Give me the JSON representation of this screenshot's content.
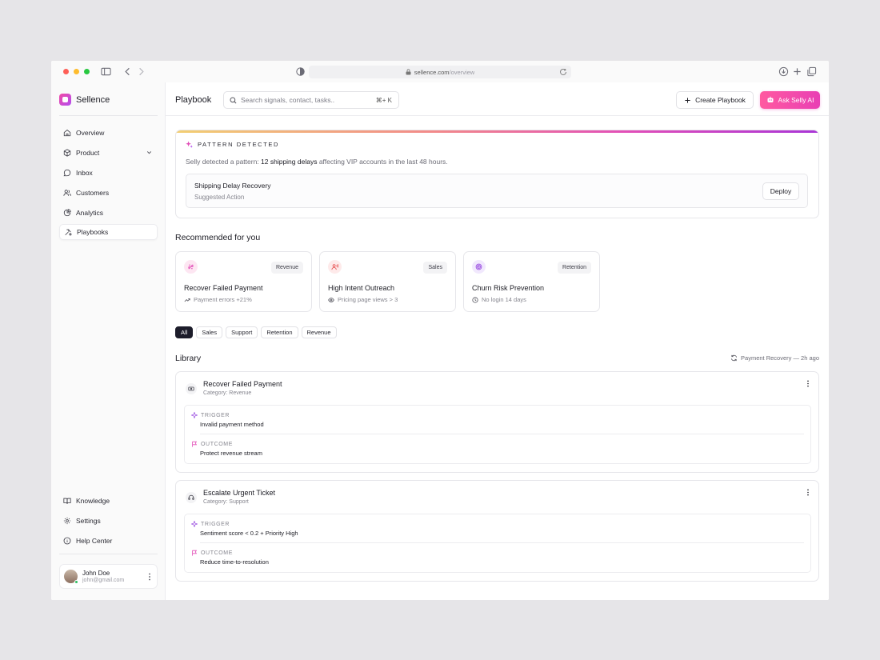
{
  "browser": {
    "url_host": "sellence.com",
    "url_path": "/overview"
  },
  "brand": {
    "name": "Sellence"
  },
  "sidebar": {
    "items": [
      {
        "label": "Overview",
        "icon": "home-icon"
      },
      {
        "label": "Product",
        "icon": "box-icon"
      },
      {
        "label": "Inbox",
        "icon": "chat-icon"
      },
      {
        "label": "Customers",
        "icon": "users-icon"
      },
      {
        "label": "Analytics",
        "icon": "chart-icon"
      },
      {
        "label": "Playbooks",
        "icon": "playbook-icon"
      }
    ],
    "bottom_items": [
      {
        "label": "Knowledge",
        "icon": "book-icon"
      },
      {
        "label": "Settings",
        "icon": "gear-icon"
      },
      {
        "label": "Help Center",
        "icon": "info-icon"
      }
    ],
    "user": {
      "name": "John Doe",
      "email": "john@gmail.com"
    }
  },
  "header": {
    "title": "Playbook",
    "search_placeholder": "Search signals, contact, tasks..",
    "search_shortcut": "⌘+ K",
    "create_label": "Create Playbook",
    "ai_label": "Ask Selly AI"
  },
  "pattern": {
    "label": "PATTERN DETECTED",
    "text_before": "Selly detected a pattern: ",
    "text_bold": "12 shipping delays",
    "text_after": " affecting VIP accounts in the last 48 hours.",
    "action_title": "Shipping Delay Recovery",
    "action_sub": "Suggested Action",
    "deploy_label": "Deploy"
  },
  "recommended": {
    "title": "Recommended for you",
    "cards": [
      {
        "title": "Recover Failed Payment",
        "tag": "Revenue",
        "meta": "Payment errors +21%"
      },
      {
        "title": "High Intent Outreach",
        "tag": "Sales",
        "meta": "Pricing page views > 3"
      },
      {
        "title": "Churn Risk Prevention",
        "tag": "Retention",
        "meta": "No login 14 days"
      }
    ]
  },
  "filters": [
    "All",
    "Sales",
    "Support",
    "Retention",
    "Revenue"
  ],
  "library": {
    "title": "Library",
    "recent": "Payment Recovery — 2h ago",
    "trigger_label": "TRIGGER",
    "outcome_label": "OUTCOME",
    "items": [
      {
        "title": "Recover Failed Payment",
        "category": "Category: Revenue",
        "trigger": "Invalid payment method",
        "outcome": "Protect revenue stream"
      },
      {
        "title": "Escalate Urgent Ticket",
        "category": "Category: Support",
        "trigger": "Sentiment score < 0.2 + Priority High",
        "outcome": "Reduce time-to-resolution"
      }
    ]
  },
  "colors": {
    "accent": "#e93fb4",
    "active_chip": "#1c1c2a"
  }
}
